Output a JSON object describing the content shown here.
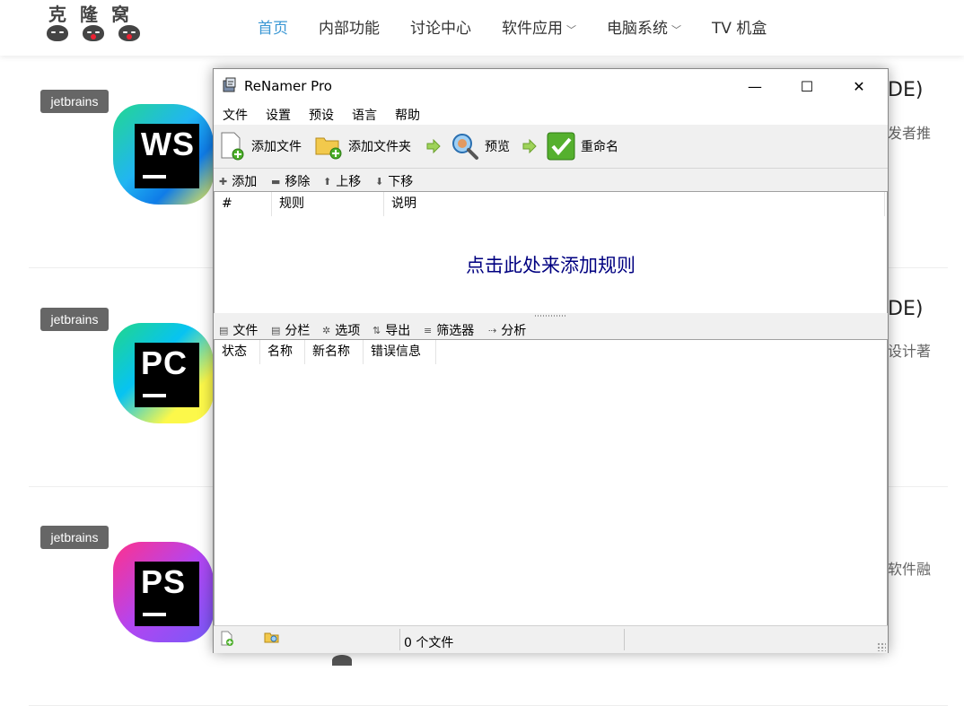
{
  "site": {
    "logo_text": "克隆窝",
    "nav": [
      {
        "label": "首页",
        "active": true,
        "has_menu": false
      },
      {
        "label": "内部功能",
        "active": false,
        "has_menu": false
      },
      {
        "label": "讨论中心",
        "active": false,
        "has_menu": false
      },
      {
        "label": "软件应用",
        "active": false,
        "has_menu": true
      },
      {
        "label": "电脑系统",
        "active": false,
        "has_menu": true
      },
      {
        "label": "TV 机盒",
        "active": false,
        "has_menu": false
      }
    ],
    "posts": [
      {
        "tag": "jetbrains",
        "logo_letters": "WS",
        "title_fragment": "DE)",
        "excerpt_fragment": "发者推"
      },
      {
        "tag": "jetbrains",
        "logo_letters": "PC",
        "title_fragment": "DE)",
        "excerpt_fragment": "设计著"
      },
      {
        "tag": "jetbrains",
        "logo_letters": "PS",
        "title_fragment": "",
        "excerpt_fragment": "软件融"
      }
    ],
    "accent_color": "#3a97d4"
  },
  "window": {
    "title": "ReNamer Pro",
    "controls": {
      "minimize": "—",
      "maximize": "☐",
      "close": "✕"
    },
    "menu": [
      "文件",
      "设置",
      "预设",
      "语言",
      "帮助"
    ],
    "toolbar": {
      "add_files": "添加文件",
      "add_folder": "添加文件夹",
      "preview": "预览",
      "rename": "重命名"
    },
    "rules_toolbar": [
      {
        "glyph": "✚",
        "label": "添加"
      },
      {
        "glyph": "▬",
        "label": "移除"
      },
      {
        "glyph": "⬆",
        "label": "上移"
      },
      {
        "glyph": "⬇",
        "label": "下移"
      }
    ],
    "rules_columns": [
      "#",
      "规则",
      "说明"
    ],
    "rules_hint": "点击此处来添加规则",
    "files_toolbar": [
      {
        "glyph": "▤",
        "label": "文件"
      },
      {
        "glyph": "▤",
        "label": "分栏"
      },
      {
        "glyph": "✲",
        "label": "选项"
      },
      {
        "glyph": "⇅",
        "label": "导出"
      },
      {
        "glyph": "≡",
        "label": "筛选器"
      },
      {
        "glyph": "⇢",
        "label": "分析"
      }
    ],
    "files_columns": [
      "状态",
      "名称",
      "新名称",
      "错误信息"
    ],
    "status_text": "0 个文件",
    "hint_color": "#000080"
  }
}
